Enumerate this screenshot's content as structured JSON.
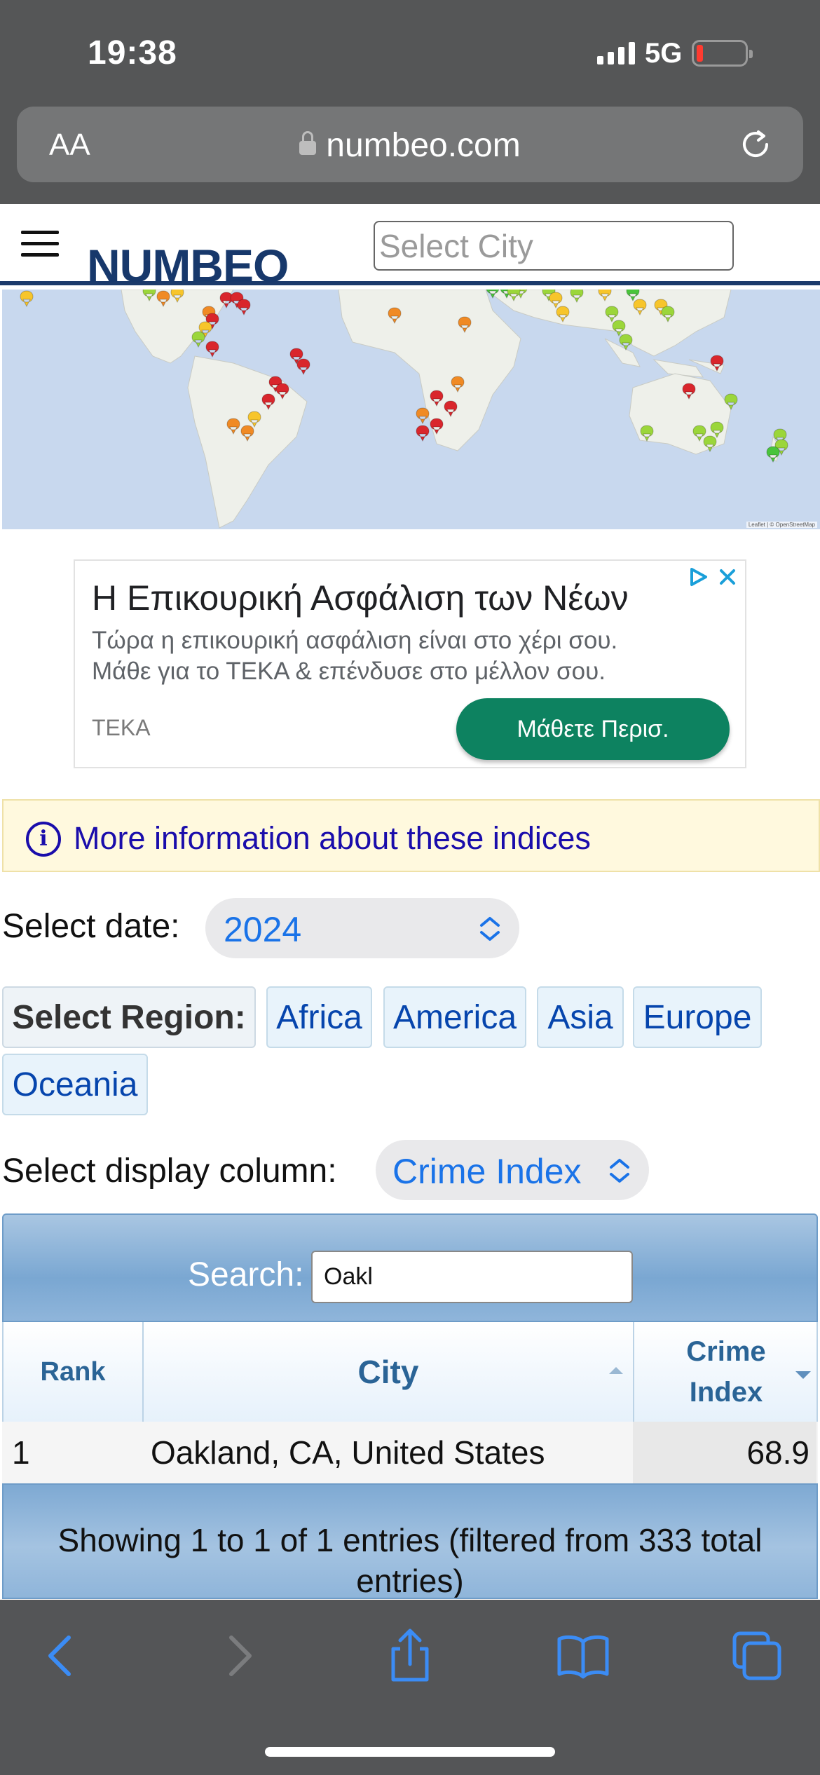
{
  "status_bar": {
    "time": "19:38",
    "network": "5G",
    "battery_level_fraction": 0.12
  },
  "browser": {
    "aa_label": "AA",
    "url": "numbeo.com",
    "icons": [
      "lock-icon",
      "reload-icon",
      "back-icon",
      "forward-icon",
      "share-icon",
      "bookmarks-icon",
      "tabs-icon"
    ]
  },
  "header": {
    "logo": "NUMBEO",
    "city_placeholder": "Select City",
    "brand_color": "#17386b"
  },
  "ad": {
    "title": "Η Επικουρική Ασφάλιση των Νέων",
    "body_line1": "Τώρα η επικουρική ασφάλιση είναι στο χέρι σου.",
    "body_line2": "Μάθε για το ΤΕΚΑ & επένδυσε στο μέλλον σου.",
    "brand": "TEKA",
    "cta": "Μάθετε Περισ.",
    "cta_color": "#0d8260"
  },
  "info": {
    "text": "More information about these indices"
  },
  "filters": {
    "date_label": "Select date:",
    "date_value": "2024",
    "region_label": "Select Region:",
    "regions": [
      "Africa",
      "America",
      "Asia",
      "Europe",
      "Oceania"
    ],
    "column_label": "Select display column:",
    "column_value": "Crime Index"
  },
  "table": {
    "search_label": "Search:",
    "search_value": "Oakl",
    "headers": {
      "rank": "Rank",
      "city": "City",
      "crime_line1": "Crime",
      "crime_line2": "Index"
    },
    "rows": [
      {
        "rank": "1",
        "city": "Oakland, CA, United States",
        "crime_index": "68.9"
      }
    ],
    "footer": "Showing 1 to 1 of 1 entries (filtered from 333 total entries)"
  },
  "map": {
    "marker_colors": [
      "#d9262c",
      "#f08a24",
      "#f7c52b",
      "#9bd63a",
      "#49c43b"
    ]
  }
}
